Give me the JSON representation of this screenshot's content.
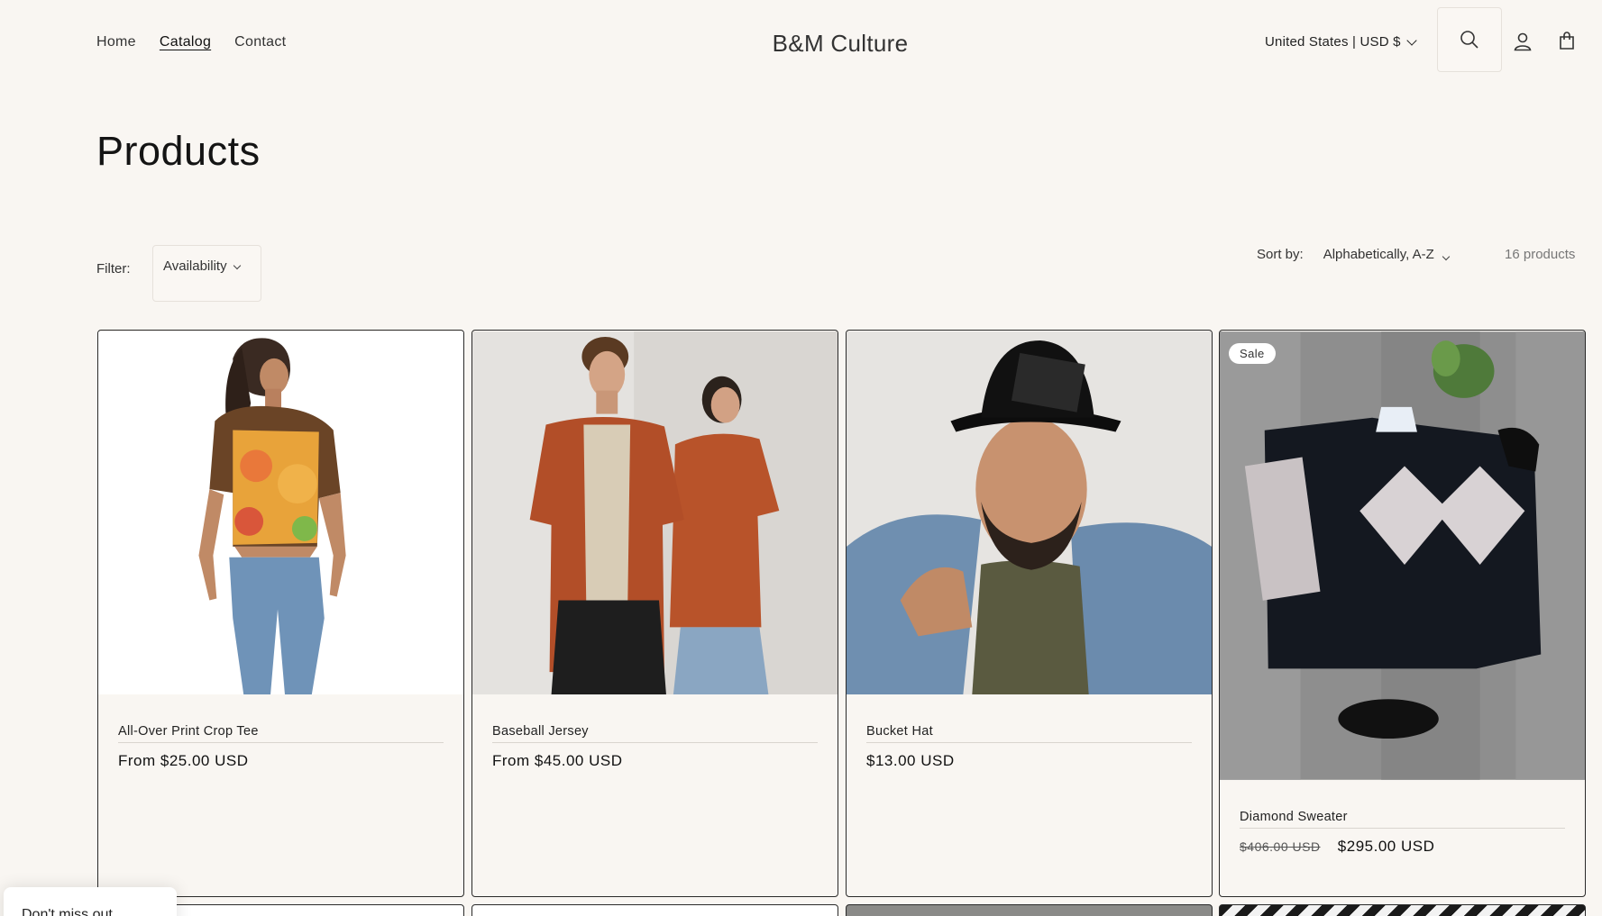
{
  "nav": {
    "home": "Home",
    "catalog": "Catalog",
    "contact": "Contact"
  },
  "brand": "B&M Culture",
  "locale": "United States | USD $",
  "icons": {
    "search": "search-icon",
    "account": "account-icon",
    "cart": "cart-icon"
  },
  "page_title": "Products",
  "toolbar": {
    "filter_label": "Filter:",
    "availability": "Availability",
    "sort_label": "Sort by:",
    "sort_value": "Alphabetically, A-Z",
    "count": "16 products"
  },
  "products": [
    {
      "name": "All-Over Print Crop Tee",
      "price": "From $25.00 USD"
    },
    {
      "name": "Baseball Jersey",
      "price": "From $45.00 USD"
    },
    {
      "name": "Bucket Hat",
      "price": "$13.00 USD"
    },
    {
      "name": "Diamond Sweater",
      "old_price": "$406.00 USD",
      "price": "$295.00 USD",
      "badge": "Sale"
    }
  ],
  "popup": {
    "text": "Don't miss out"
  }
}
